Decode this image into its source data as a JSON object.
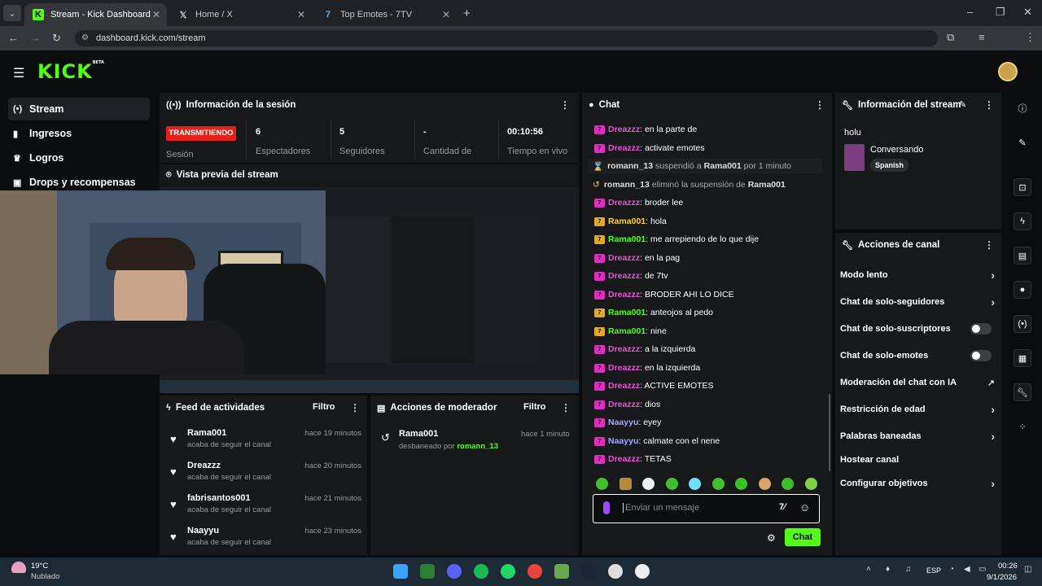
{
  "browser": {
    "tabs": [
      {
        "label": "Stream - Kick Dashboard"
      },
      {
        "label": "Home / X"
      },
      {
        "label": "Top Emotes - 7TV"
      }
    ],
    "url": "dashboard.kick.com/stream"
  },
  "logo": {
    "text": "KICK",
    "beta": "BETA"
  },
  "sidebar": {
    "items": [
      {
        "label": "Stream"
      },
      {
        "label": "Ingresos"
      },
      {
        "label": "Logros"
      },
      {
        "label": "Drops y recompensas"
      }
    ]
  },
  "session": {
    "title": "Información de la sesión",
    "live_badge": "TRANSMITIENDO",
    "session_label": "Sesión",
    "stats": [
      {
        "value": "6",
        "label": "Espectadores"
      },
      {
        "value": "5",
        "label": "Seguidores"
      },
      {
        "value": "-",
        "label": "Cantidad de"
      },
      {
        "value": "00:10:56",
        "label": "Tiempo en vivo"
      }
    ]
  },
  "preview": {
    "title": "Vista previa del stream"
  },
  "activity": {
    "title": "Feed de actividades",
    "filter": "Filtro",
    "items": [
      {
        "name": "Rama001",
        "action": "acaba de seguir el canal",
        "time": "hace 19 minutos"
      },
      {
        "name": "Dreazzz",
        "action": "acaba de seguir el canal",
        "time": "hace 20 minutos"
      },
      {
        "name": "fabrisantos001",
        "action": "acaba de seguir el canal",
        "time": "hace 21 minutos"
      },
      {
        "name": "Naayyu",
        "action": "acaba de seguir el canal",
        "time": "hace 23 minutos"
      }
    ]
  },
  "modactions": {
    "title": "Acciones de moderador",
    "filter": "Filtro",
    "items": [
      {
        "name": "Rama001",
        "action": "desbaneado por",
        "by": "romann_13",
        "time": "hace 1 minuto"
      }
    ]
  },
  "chat": {
    "title": "Chat",
    "messages": [
      {
        "user": "Dreazzz",
        "text": ": en la parte de"
      },
      {
        "user": "Dreazzz",
        "text": ": activate emotes"
      },
      {
        "user": "Dreazzz",
        "text": ": broder lee"
      },
      {
        "user": "Rama001",
        "text": ": hola"
      },
      {
        "user": "Rama001",
        "text": ": me arrepiendo de lo que dije"
      },
      {
        "user": "Dreazzz",
        "text": ": en la pag"
      },
      {
        "user": "Dreazzz",
        "text": ": de 7tv"
      },
      {
        "user": "Dreazzz",
        "text": ": BRODER AHI LO DICE"
      },
      {
        "user": "Rama001",
        "text": ": anteojos al pedo"
      },
      {
        "user": "Rama001",
        "text": ": nine"
      },
      {
        "user": "Dreazzz",
        "text": ": a la izquierda"
      },
      {
        "user": "Dreazzz",
        "text": ": en la izquierda"
      },
      {
        "user": "Dreazzz",
        "text": ": ACTIVE EMOTES"
      },
      {
        "user": "Dreazzz",
        "text": ": dios"
      },
      {
        "user": "Naayyu",
        "text": ": eyey"
      },
      {
        "user": "Naayyu",
        "text": ": calmate con el nene"
      },
      {
        "user": "Dreazzz",
        "text": ": TETAS"
      }
    ],
    "system": [
      {
        "actor": "romann_13",
        "verb": "suspendió a",
        "target": "Rama001",
        "suffix": "por 1 minuto"
      },
      {
        "actor": "romann_13",
        "verb": "eliminó la suspensión de",
        "target": "Rama001",
        "suffix": ""
      }
    ],
    "input_placeholder": "Enviar un mensaje",
    "send_label": "Chat"
  },
  "streaminfo": {
    "title": "Información del stream",
    "stream_title": "holu",
    "category": "Conversando",
    "language": "Spanish"
  },
  "channelactions": {
    "title": "Acciones de canal",
    "items": [
      {
        "label": "Modo lento"
      },
      {
        "label": "Chat de solo-seguidores"
      },
      {
        "label": "Chat de solo-suscriptores"
      },
      {
        "label": "Chat de solo-emotes"
      },
      {
        "label": "Moderación del chat con IA"
      },
      {
        "label": "Restricción de edad"
      },
      {
        "label": "Palabras baneadas"
      },
      {
        "label": "Hostear canal"
      },
      {
        "label": "Configurar objetivos"
      }
    ]
  },
  "taskbar": {
    "weather_temp": "19°C",
    "weather_desc": "Nublado",
    "lang": "ESP",
    "time": "00:26",
    "date": "9/1/2026"
  },
  "colors": {
    "accent": "#53fc18",
    "live": "#e4201b",
    "panel": "#17181a",
    "bg": "#0b0c0d"
  }
}
